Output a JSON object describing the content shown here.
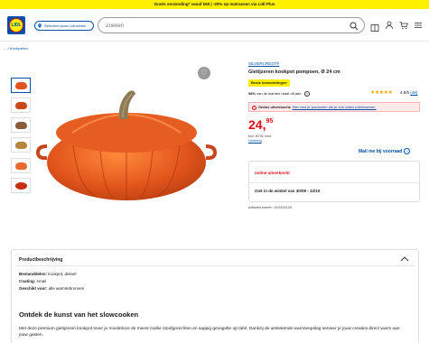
{
  "promo": "Gratis verzending* vanaf €60 | -20% op matrassen via Lidl Plus",
  "header": {
    "logo_text": "LIDL",
    "store_selector": "Selecteer jouw Lidl-winkel",
    "search_placeholder": "Zoeken",
    "icons": [
      "catalog-icon",
      "account-icon",
      "cart-icon",
      "menu-icon"
    ]
  },
  "breadcrumb": "... / Kookpotten",
  "product": {
    "brand": "SILVERCREST®",
    "title": "Gietijzeren kookpot pompoen, Ø 24 cm",
    "badge": "Beste beoordelingen",
    "recommend_pct": "98%",
    "recommend_text": "van de klanten raadt dit aan",
    "stars": "★★★★★",
    "rating": "4,8/5",
    "rating_count": "(48)",
    "alert_prefix": "Online uitverkocht:",
    "alert_link": "Hier vind je producten die je ook zullen interesseren.",
    "price_main": "24,",
    "price_cents": "95",
    "price_note_1": "Incl. BTW, excl.",
    "price_note_2": "Levering",
    "mail_label": "Mail me bij voorraad",
    "online_status": "online uitverkocht",
    "instore_text": "Ook in de winkel van 30/09 - 12/10",
    "article_number": "Artikelnummer: 100410129"
  },
  "description": {
    "header": "Productbeschrijving",
    "lines": [
      {
        "label": "Bestanddelen:",
        "value": "kookpot, deksel"
      },
      {
        "label": "Coating:",
        "value": "email"
      },
      {
        "label": "Geschikt voor:",
        "value": "alle warmtebronnen"
      }
    ],
    "title": "Ontdek de kunst van het slowcooken",
    "text": "Met deze premium gietijzeren kookpot tover je moeiteloos de meest malse stoofgerechten en sappig gevogelte op tafel. Dankzij de uitstekende warmteopslag serveer je jouw creaties direct warm aan jouw gasten."
  },
  "colors": {
    "brand_blue": "#0050aa",
    "brand_yellow": "#fff000",
    "sale_red": "#e60a14",
    "pot_orange": "#e2551c"
  }
}
